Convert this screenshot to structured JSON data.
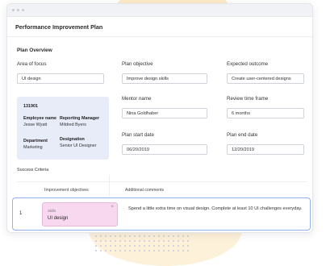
{
  "app_title": "Performance Improvement Plan",
  "section_title": "Plan Overview",
  "fields": {
    "area_of_focus": {
      "label": "Area of focus",
      "value": "UI design"
    },
    "plan_objective": {
      "label": "Plan objective",
      "value": "Improve design skills"
    },
    "expected_outcome": {
      "label": "Expected outcome",
      "value": "Create user-centered designs"
    },
    "mentor_name": {
      "label": "Mentor name",
      "value": "Nina Goldhaber"
    },
    "review_time_frame": {
      "label": "Review time frame",
      "value": "6 months"
    },
    "plan_start_date": {
      "label": "Plan start date",
      "value": "06/20/2019"
    },
    "plan_end_date": {
      "label": "Plan end date",
      "value": "12/20/2019"
    }
  },
  "employee": {
    "id": "131901",
    "employee_name_label": "Employee name",
    "employee_name": "Jesse Wyatt",
    "reporting_manager_label": "Reporting Manager",
    "reporting_manager": "Mildred Byers",
    "department_label": "Department",
    "department": "Marketing",
    "designation_label": "Designation",
    "designation": "Senior UI Designer"
  },
  "success_criteria_label": "Success Criteria",
  "table": {
    "headers": [
      "Improvement objectives",
      "Additional comments"
    ],
    "rows": [
      {
        "number": "1",
        "chip_label": "Skills",
        "chip_value": "UI design",
        "comment": "Spend a little extra time on visual design. Complete at least 10 UI challenges everyday."
      }
    ]
  },
  "icons": {
    "chip_close": "×"
  }
}
